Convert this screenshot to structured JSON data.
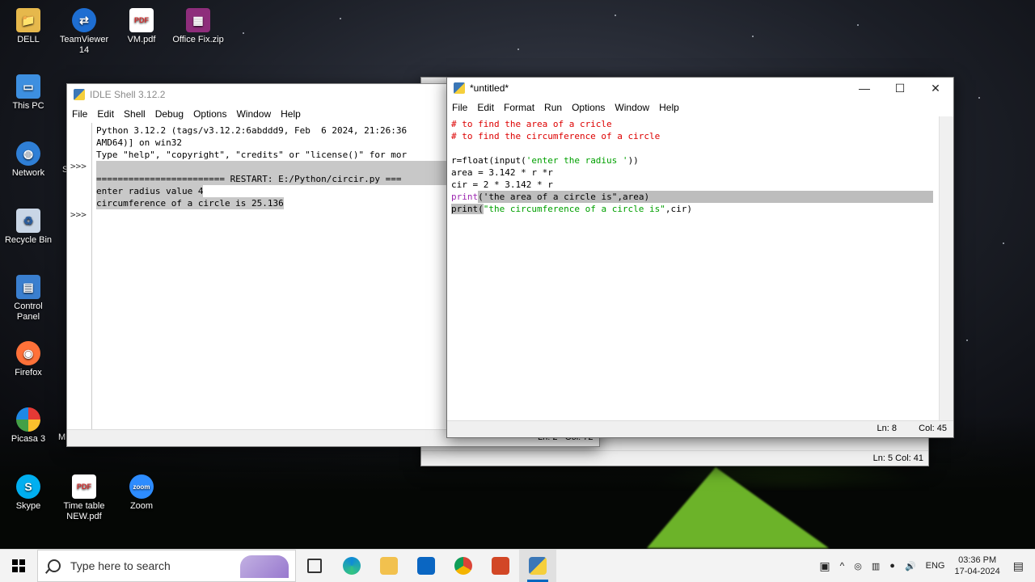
{
  "desktop": {
    "icons": [
      {
        "label": "DELL",
        "icon": "folder-user-icon",
        "color": "#e6b84c"
      },
      {
        "label": "TeamViewer 14",
        "icon": "teamviewer-icon",
        "color": "#1e6ed2"
      },
      {
        "label": "VM.pdf",
        "icon": "pdf-file-icon",
        "color": "#d32f2f"
      },
      {
        "label": "Office Fix.zip",
        "icon": "winrar-archive-icon",
        "color": "#8e2d7b"
      },
      {
        "label": "This PC",
        "icon": "computer-icon",
        "color": "#3d8fe0"
      },
      {
        "label": "Network",
        "icon": "network-globe-icon",
        "color": "#2f7fd6"
      },
      {
        "label": "Recycle Bin",
        "icon": "recycle-bin-icon",
        "color": "#c9d6e6"
      },
      {
        "label": "Control Panel",
        "icon": "control-panel-icon",
        "color": "#3a7fcf"
      },
      {
        "label": "Firefox",
        "icon": "firefox-icon",
        "color": "#ff7139"
      },
      {
        "label": "Picasa 3",
        "icon": "picasa-icon",
        "color": "#6bbf3a"
      },
      {
        "label": "Skype",
        "icon": "skype-icon",
        "color": "#00aff0"
      },
      {
        "label": "Time table NEW.pdf",
        "icon": "pdf-file-icon",
        "color": "#d32f2f"
      },
      {
        "label": "Zoom",
        "icon": "zoom-icon",
        "color": "#2d8cff"
      }
    ],
    "partial_labels": [
      "S",
      "M"
    ]
  },
  "shell_window": {
    "title": "IDLE Shell 3.12.2",
    "menu": [
      "File",
      "Edit",
      "Shell",
      "Debug",
      "Options",
      "Window",
      "Help"
    ],
    "prompts": [
      ">>>",
      ">>>"
    ],
    "lines": [
      "Python 3.12.2 (tags/v3.12.2:6abddd9, Feb  6 2024, 21:26:36",
      "AMD64)] on win32",
      "Type \"help\", \"copyright\", \"credits\" or \"license()\" for mor",
      "",
      "======================== RESTART: E:/Python/circir.py ===",
      "enter radius value 4",
      "circumference of a circle is 25.136"
    ],
    "status": "Ln: 2   Col: 72"
  },
  "back_window": {
    "status": "Ln: 5   Col: 41"
  },
  "editor_window": {
    "title": "*untitled*",
    "menu": [
      "File",
      "Edit",
      "Format",
      "Run",
      "Options",
      "Window",
      "Help"
    ],
    "code": {
      "c1": "# to find the area of a cricle",
      "c2": "# to find the circumference of a circle",
      "l4_a": "r=float(input(",
      "l4_s": "'enter the radius '",
      "l4_b": "))",
      "l5": "area = 3.142 * r *r",
      "l6": "cir = 2 * 3.142 * r",
      "l7_kw": "print",
      "l7_a": "(",
      "l7_s": "'the area of a circle is\"",
      "l7_b": ",area)",
      "l8_kw": "print",
      "l8_a": "(",
      "l8_s": "\"the circumference of a circle is\"",
      "l8_b": ",cir)"
    },
    "status_ln": "Ln: 8",
    "status_col": "Col: 45",
    "controls": {
      "minimize": "—",
      "maximize": "☐",
      "close": "✕"
    }
  },
  "taskbar": {
    "search_placeholder": "Type here to search",
    "apps": [
      {
        "name": "task-view",
        "color": "#333333"
      },
      {
        "name": "edge",
        "color": "#0f8ad8"
      },
      {
        "name": "file-explorer",
        "color": "#f2c14e"
      },
      {
        "name": "mail",
        "color": "#0a66c2"
      },
      {
        "name": "chrome",
        "color": "#db4437"
      },
      {
        "name": "powerpoint",
        "color": "#d24726"
      },
      {
        "name": "python-idle",
        "color": "#3b77b7"
      }
    ],
    "tray": {
      "language": "ENG",
      "time": "03:36 PM",
      "date": "17-04-2024"
    }
  }
}
